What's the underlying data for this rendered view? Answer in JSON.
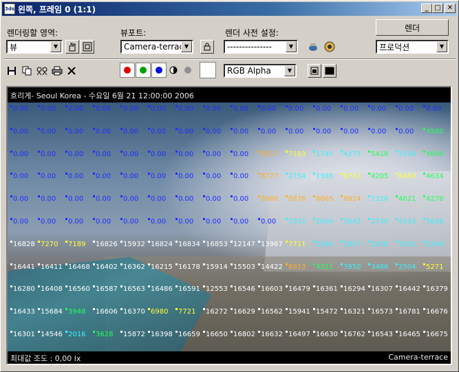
{
  "window": {
    "title": "왼쪽, 프레임 0 (1:1)",
    "app_icon_text": "3ds"
  },
  "controls": {
    "render_area_label": "렌더링할 영역:",
    "render_area_value": "뷰",
    "viewport_label": "뷰포트:",
    "viewport_value": "Camera-terrace",
    "preset_label": "렌더 사전 설정:",
    "preset_value": "---------------",
    "render_button": "렌더",
    "mode_value": "프로덕션",
    "channel_value": "RGB Alpha"
  },
  "render": {
    "header_text": "흐리게- Seoul Korea - 수요일 6월 21 12:00:00 2006",
    "footer_left": "최대값 조도 : 0,00 lx",
    "footer_right": "Camera-terrace"
  },
  "colors": {
    "blue": "#1f2fff",
    "white": "#ffffff",
    "orange": "#ffae2a",
    "yellow": "#ffff33",
    "cyan": "#3cf0ff",
    "green": "#22ff5a"
  },
  "grid": [
    [
      [
        "0.00",
        "b"
      ],
      [
        "0.00",
        "b"
      ],
      [
        "0.00",
        "b"
      ],
      [
        "0.00",
        "b"
      ],
      [
        "0.00",
        "b"
      ],
      [
        "0.00",
        "b"
      ],
      [
        "0.00",
        "b"
      ],
      [
        "0.00",
        "b"
      ],
      [
        "0.00",
        "b"
      ],
      [
        "0.00",
        "b"
      ],
      [
        "0.00",
        "b"
      ],
      [
        "0.00",
        "b"
      ],
      [
        "0.00",
        "b"
      ],
      [
        "0.00",
        "b"
      ],
      [
        "0.00",
        "b"
      ],
      [
        "0.00",
        "b"
      ]
    ],
    [
      [
        "0.00",
        "b"
      ],
      [
        "0.00",
        "b"
      ],
      [
        "0.00",
        "b"
      ],
      [
        "0.00",
        "b"
      ],
      [
        "0.00",
        "b"
      ],
      [
        "0.00",
        "b"
      ],
      [
        "0.00",
        "b"
      ],
      [
        "0.00",
        "b"
      ],
      [
        "0.00",
        "b"
      ],
      [
        "0.00",
        "b"
      ],
      [
        "0.00",
        "b"
      ],
      [
        "0.00",
        "b"
      ],
      [
        "0.00",
        "b"
      ],
      [
        "0.00",
        "b"
      ],
      [
        "0.00",
        "b"
      ],
      [
        "4580",
        "g"
      ]
    ],
    [
      [
        "0.00",
        "b"
      ],
      [
        "0.00",
        "b"
      ],
      [
        "0.00",
        "b"
      ],
      [
        "0.00",
        "b"
      ],
      [
        "0.00",
        "b"
      ],
      [
        "0.00",
        "b"
      ],
      [
        "0.00",
        "b"
      ],
      [
        "0.00",
        "b"
      ],
      [
        "0.00",
        "b"
      ],
      [
        "8517",
        "o"
      ],
      [
        "7183",
        "y"
      ],
      [
        "1745",
        "c"
      ],
      [
        "4273",
        "c"
      ],
      [
        "5418",
        "g"
      ],
      [
        "3194",
        "c"
      ],
      [
        "4648",
        "g"
      ]
    ],
    [
      [
        "0.00",
        "b"
      ],
      [
        "0.00",
        "b"
      ],
      [
        "0.00",
        "b"
      ],
      [
        "0.00",
        "b"
      ],
      [
        "0.00",
        "b"
      ],
      [
        "0.00",
        "b"
      ],
      [
        "0.00",
        "b"
      ],
      [
        "0.00",
        "b"
      ],
      [
        "0.00",
        "b"
      ],
      [
        "8727",
        "o"
      ],
      [
        "2754",
        "c"
      ],
      [
        "1985",
        "c"
      ],
      [
        "6732",
        "y"
      ],
      [
        "4205",
        "g"
      ],
      [
        "6483",
        "y"
      ],
      [
        "4634",
        "g"
      ]
    ],
    [
      [
        "0.00",
        "b"
      ],
      [
        "0.00",
        "b"
      ],
      [
        "0.00",
        "b"
      ],
      [
        "0.00",
        "b"
      ],
      [
        "0.00",
        "b"
      ],
      [
        "0.00",
        "b"
      ],
      [
        "0.00",
        "b"
      ],
      [
        "0.00",
        "b"
      ],
      [
        "0.00",
        "b"
      ],
      [
        "8960",
        "o"
      ],
      [
        "8876",
        "o"
      ],
      [
        "8665",
        "o"
      ],
      [
        "8924",
        "o"
      ],
      [
        "1326",
        "c"
      ],
      [
        "4621",
        "g"
      ],
      [
        "4278",
        "g"
      ]
    ],
    [
      [
        "0.00",
        "b"
      ],
      [
        "0.00",
        "b"
      ],
      [
        "0.00",
        "b"
      ],
      [
        "0.00",
        "b"
      ],
      [
        "0.00",
        "b"
      ],
      [
        "0.00",
        "b"
      ],
      [
        "0.00",
        "b"
      ],
      [
        "0.00",
        "b"
      ],
      [
        "0.00",
        "b"
      ],
      [
        "0.00",
        "b"
      ],
      [
        "2972",
        "c"
      ],
      [
        "2604",
        "c"
      ],
      [
        "2642",
        "c"
      ],
      [
        "2730",
        "c"
      ],
      [
        "4193",
        "c"
      ],
      [
        "3636",
        "c"
      ]
    ],
    [
      [
        "16828",
        "w"
      ],
      [
        "7270",
        "y"
      ],
      [
        "7189",
        "y"
      ],
      [
        "16826",
        "w"
      ],
      [
        "15932",
        "w"
      ],
      [
        "16824",
        "w"
      ],
      [
        "16834",
        "w"
      ],
      [
        "16853",
        "w"
      ],
      [
        "12147",
        "w"
      ],
      [
        "13967",
        "w"
      ],
      [
        "7711",
        "y"
      ],
      [
        "2396",
        "c"
      ],
      [
        "2827",
        "c"
      ],
      [
        "2938",
        "c"
      ],
      [
        "3301",
        "c"
      ],
      [
        "2289",
        "c"
      ]
    ],
    [
      [
        "16441",
        "w"
      ],
      [
        "16411",
        "w"
      ],
      [
        "16468",
        "w"
      ],
      [
        "16402",
        "w"
      ],
      [
        "16362",
        "w"
      ],
      [
        "16215",
        "w"
      ],
      [
        "16178",
        "w"
      ],
      [
        "15914",
        "w"
      ],
      [
        "15503",
        "w"
      ],
      [
        "14422",
        "w"
      ],
      [
        "8913",
        "o"
      ],
      [
        "4311",
        "g"
      ],
      [
        "3950",
        "c"
      ],
      [
        "3486",
        "c"
      ],
      [
        "2504",
        "c"
      ],
      [
        "5271",
        "y"
      ]
    ],
    [
      [
        "16280",
        "w"
      ],
      [
        "16408",
        "w"
      ],
      [
        "16560",
        "w"
      ],
      [
        "16587",
        "w"
      ],
      [
        "16563",
        "w"
      ],
      [
        "16486",
        "w"
      ],
      [
        "16591",
        "w"
      ],
      [
        "12553",
        "w"
      ],
      [
        "16546",
        "w"
      ],
      [
        "16603",
        "w"
      ],
      [
        "16479",
        "w"
      ],
      [
        "16361",
        "w"
      ],
      [
        "16294",
        "w"
      ],
      [
        "16307",
        "w"
      ],
      [
        "16442",
        "w"
      ],
      [
        "16379",
        "w"
      ]
    ],
    [
      [
        "16433",
        "w"
      ],
      [
        "15684",
        "w"
      ],
      [
        "3948",
        "g"
      ],
      [
        "16606",
        "w"
      ],
      [
        "16370",
        "w"
      ],
      [
        "6980",
        "y"
      ],
      [
        "7721",
        "y"
      ],
      [
        "16272",
        "w"
      ],
      [
        "16629",
        "w"
      ],
      [
        "16562",
        "w"
      ],
      [
        "15941",
        "w"
      ],
      [
        "15472",
        "w"
      ],
      [
        "16321",
        "w"
      ],
      [
        "16573",
        "w"
      ],
      [
        "16781",
        "w"
      ],
      [
        "16676",
        "w"
      ]
    ],
    [
      [
        "16301",
        "w"
      ],
      [
        "14546",
        "w"
      ],
      [
        "2016",
        "c"
      ],
      [
        "3628",
        "g"
      ],
      [
        "15872",
        "w"
      ],
      [
        "16398",
        "w"
      ],
      [
        "16659",
        "w"
      ],
      [
        "16650",
        "w"
      ],
      [
        "16802",
        "w"
      ],
      [
        "16632",
        "w"
      ],
      [
        "16497",
        "w"
      ],
      [
        "16630",
        "w"
      ],
      [
        "16762",
        "w"
      ],
      [
        "16543",
        "w"
      ],
      [
        "16465",
        "w"
      ],
      [
        "16675",
        "w"
      ]
    ]
  ]
}
